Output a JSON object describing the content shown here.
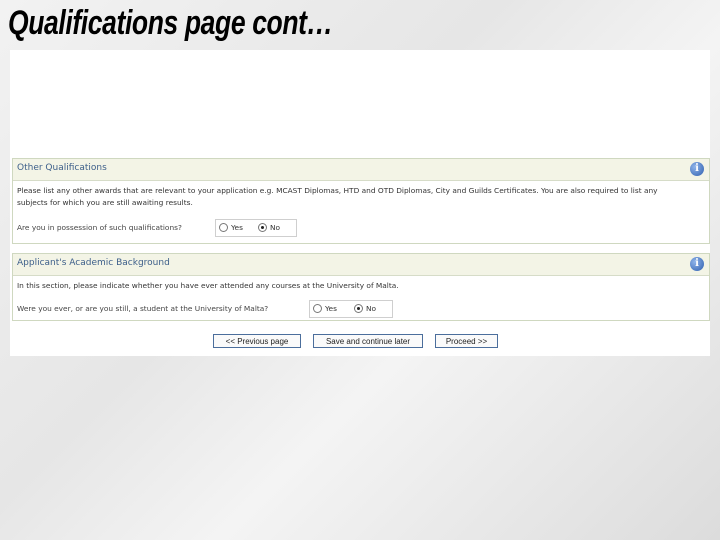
{
  "slide": {
    "title": "Qualifications page cont…"
  },
  "other_qualifications": {
    "heading": "Other Qualifications",
    "description_line1": "Please list any other awards that are relevant to your application e.g. MCAST Diplomas, HTD and OTD Diplomas, City and Guilds Certificates. You are also required to list any",
    "description_line2": "subjects for which you are still awaiting results.",
    "question": "Are you in possession of such qualifications?",
    "options": [
      "Yes",
      "No"
    ],
    "selected": "No"
  },
  "academic_background": {
    "heading": "Applicant's Academic Background",
    "description": "In this section, please indicate whether you have ever attended any courses at the University of Malta.",
    "question": "Were you ever, or are you still, a student at the University of Malta?",
    "options": [
      "Yes",
      "No"
    ],
    "selected": "No"
  },
  "navigation": {
    "previous": "<< Previous page",
    "save": "Save and continue later",
    "proceed": "Proceed >>"
  },
  "icons": {
    "info": "info-icon"
  }
}
